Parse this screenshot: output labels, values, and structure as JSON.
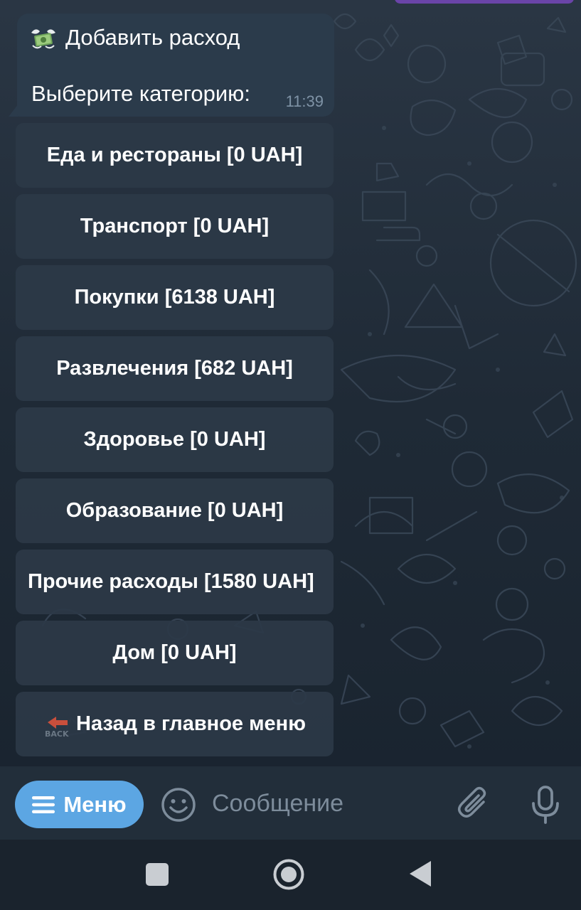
{
  "chat": {
    "message": {
      "icon": "money-with-wings-icon",
      "title": "Добавить расход",
      "prompt": "Выберите категорию:",
      "time": "11:39"
    },
    "keyboard": [
      {
        "label": "Еда и рестораны [0 UAH]"
      },
      {
        "label": "Транспорт [0 UAH]"
      },
      {
        "label": "Покупки [6138 UAH]"
      },
      {
        "label": "Развлечения [682 UAH]"
      },
      {
        "label": "Здоровье [0 UAH]"
      },
      {
        "label": "Образование [0 UAH]"
      },
      {
        "label": "Прочие расходы [1580 UAH]"
      },
      {
        "label": "Дом [0 UAH]"
      },
      {
        "label": "Назад в главное меню",
        "icon": "back-arrow-icon",
        "icon_text": "BACK"
      }
    ]
  },
  "input_bar": {
    "menu_label": "Меню",
    "placeholder": "Сообщение",
    "icons": [
      "hamburger-icon",
      "emoji-icon",
      "paperclip-icon",
      "microphone-icon"
    ]
  },
  "nav_bar": {
    "icons": [
      "recents-square-icon",
      "home-circle-icon",
      "back-triangle-icon"
    ]
  },
  "colors": {
    "menu_button": "#5ca6e3",
    "bubble": "#2b3b4b",
    "keyboard_button": "#2c3947",
    "input_bar": "#222e3a",
    "nav_bar": "#1a232d",
    "time_text": "#7f93a6",
    "placeholder_text": "#7d8c9b"
  }
}
